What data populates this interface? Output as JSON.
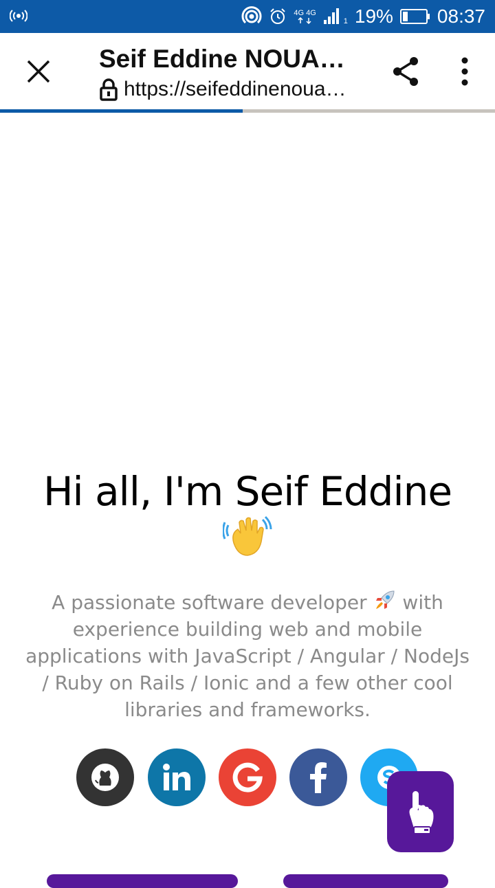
{
  "status_bar": {
    "network_label": "4G 4G",
    "sim_slot": "1",
    "battery": "19%",
    "time": "08:37"
  },
  "toolbar": {
    "title": "Seif Eddine NOUA…",
    "url": "https://seifeddinenoua…"
  },
  "page_load_progress": 0.49,
  "hero": {
    "title": "Hi all, I'm Seif Eddine",
    "description_before": "A passionate software developer",
    "description_after": "with experience building web and mobile applications with JavaScript / Angular / NodeJs / Ruby on Rails / Ionic and a few other cool libraries and frameworks."
  },
  "socials": [
    {
      "name": "github",
      "color": "#333333"
    },
    {
      "name": "linkedin",
      "color": "#0e76a8"
    },
    {
      "name": "google",
      "color": "#ea4335"
    },
    {
      "name": "facebook",
      "color": "#3b5998"
    },
    {
      "name": "skype",
      "color": "#1fa9f2"
    }
  ],
  "colors": {
    "status_bar": "#0d5aa7",
    "accent_purple": "#57189a",
    "desc_gray": "#8a8a8a"
  }
}
